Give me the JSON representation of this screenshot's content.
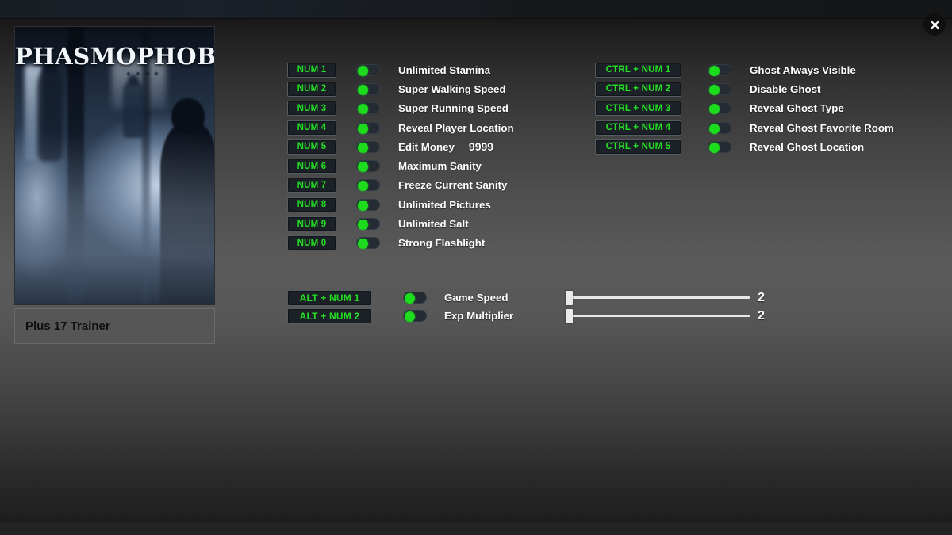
{
  "window": {
    "close_icon": "close-icon"
  },
  "game": {
    "cover_title": "PHASMOPHOBIA",
    "trainer_label": "Plus 17 Trainer"
  },
  "colors": {
    "hotkey_text": "#24e024",
    "toggle_on": "#1ddb1d",
    "cheat_text": "#ffffff",
    "hotkey_bg": "#1b2126",
    "trainer_panel": "#565656"
  },
  "cheats_column_a": [
    {
      "hotkey": "NUM 1",
      "name": "Unlimited Stamina",
      "enabled": true,
      "value": null
    },
    {
      "hotkey": "NUM 2",
      "name": "Super Walking Speed",
      "enabled": true,
      "value": null
    },
    {
      "hotkey": "NUM 3",
      "name": "Super Running Speed",
      "enabled": true,
      "value": null
    },
    {
      "hotkey": "NUM 4",
      "name": "Reveal Player Location",
      "enabled": true,
      "value": null
    },
    {
      "hotkey": "NUM 5",
      "name": "Edit Money",
      "enabled": true,
      "value": "9999"
    },
    {
      "hotkey": "NUM 6",
      "name": "Maximum Sanity",
      "enabled": true,
      "value": null
    },
    {
      "hotkey": "NUM 7",
      "name": "Freeze Current Sanity",
      "enabled": true,
      "value": null
    },
    {
      "hotkey": "NUM 8",
      "name": "Unlimited Pictures",
      "enabled": true,
      "value": null
    },
    {
      "hotkey": "NUM 9",
      "name": "Unlimited Salt",
      "enabled": true,
      "value": null
    },
    {
      "hotkey": "NUM 0",
      "name": "Strong Flashlight",
      "enabled": true,
      "value": null
    }
  ],
  "cheats_column_b": [
    {
      "hotkey": "CTRL + NUM 1",
      "name": "Ghost Always Visible",
      "enabled": true
    },
    {
      "hotkey": "CTRL + NUM 2",
      "name": "Disable Ghost",
      "enabled": true
    },
    {
      "hotkey": "CTRL + NUM 3",
      "name": "Reveal Ghost Type",
      "enabled": true
    },
    {
      "hotkey": "CTRL + NUM 4",
      "name": "Reveal Ghost Favorite Room",
      "enabled": true
    },
    {
      "hotkey": "CTRL + NUM 5",
      "name": "Reveal Ghost Location",
      "enabled": true
    }
  ],
  "sliders": [
    {
      "hotkey": "ALT + NUM 1",
      "name": "Game Speed",
      "enabled": true,
      "value": "2",
      "percent": 0
    },
    {
      "hotkey": "ALT + NUM 2",
      "name": "Exp Multiplier",
      "enabled": true,
      "value": "2",
      "percent": 0
    }
  ]
}
